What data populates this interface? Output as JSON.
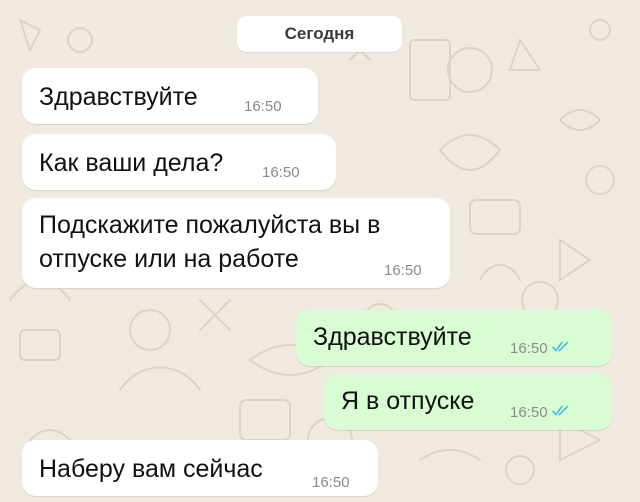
{
  "chat": {
    "date_label": "Сегодня",
    "messages": [
      {
        "direction": "incoming",
        "text": "Здравствуйте",
        "time": "16:50"
      },
      {
        "direction": "incoming",
        "text": "Как ваши дела?",
        "time": "16:50"
      },
      {
        "direction": "incoming",
        "text": "Подскажите пожалуйста вы в\nотпуске или на работе",
        "time": "16:50"
      },
      {
        "direction": "outgoing",
        "text": "Здравствуйте",
        "time": "16:50",
        "status": "read",
        "status_icon": "double-check-icon"
      },
      {
        "direction": "outgoing",
        "text": "Я в отпуске",
        "time": "16:50",
        "status": "read",
        "status_icon": "double-check-icon"
      },
      {
        "direction": "incoming",
        "text": "Наберу вам сейчас",
        "time": "16:50"
      }
    ]
  },
  "colors": {
    "wallpaper": "#efe9df",
    "incoming_bubble": "#ffffff",
    "outgoing_bubble": "#d9fdd3",
    "read_ticks": "#53bdeb",
    "timestamp": "#8a8a8a"
  }
}
